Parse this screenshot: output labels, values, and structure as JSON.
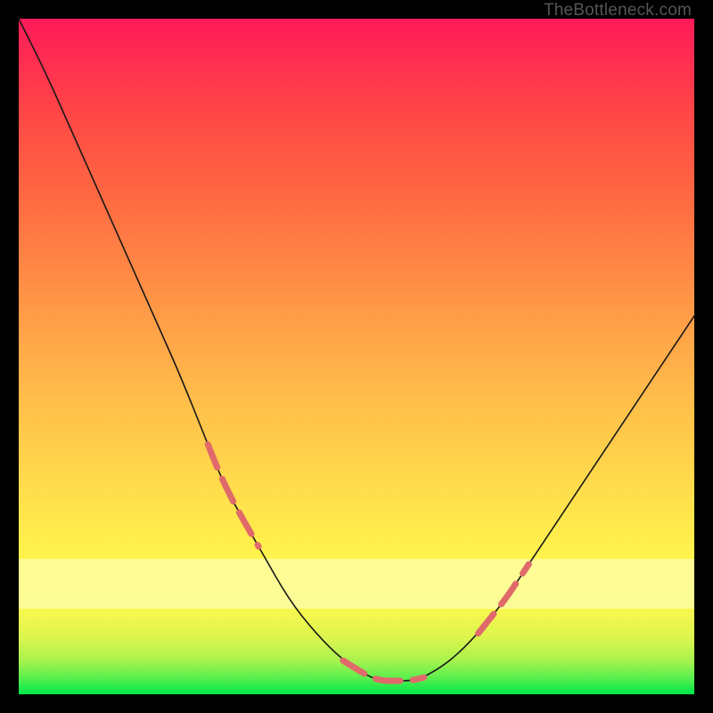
{
  "watermark": "TheBottleneck.com",
  "gradient": {
    "top": "#ff1a5a",
    "mid_upper": "#ff8244",
    "mid": "#fff84c",
    "lower_band": "#ffffd2",
    "bottom": "#00e64a"
  },
  "chart_data": {
    "type": "line",
    "title": "",
    "xlabel": "",
    "ylabel": "",
    "xlim": [
      0,
      100
    ],
    "ylim": [
      0,
      100
    ],
    "x": [
      0,
      4,
      8,
      12,
      16,
      20,
      24,
      28,
      30,
      32,
      36,
      40,
      44,
      48,
      52,
      54,
      56,
      58,
      60,
      64,
      68,
      72,
      76,
      80,
      84,
      88,
      92,
      96,
      100
    ],
    "series": [
      {
        "name": "bottleneck-curve",
        "color": "#181818",
        "values": [
          100,
          92,
          83,
          74,
          65,
          56,
          47,
          37,
          32,
          28,
          21,
          14,
          9,
          5,
          2.5,
          2,
          2,
          2,
          2.5,
          5,
          9,
          14,
          20,
          26,
          32,
          38,
          44,
          50,
          56
        ]
      }
    ],
    "annotations": [
      {
        "name": "accent-dash-left-down",
        "type": "dashed-segment",
        "color": "#e06a6a",
        "x_range": [
          28,
          36
        ],
        "note": "overlays main curve on left descending arm inside pale band"
      },
      {
        "name": "accent-dash-bottom",
        "type": "dashed-segment",
        "color": "#e06a6a",
        "x_range": [
          48,
          60
        ],
        "note": "overlays main curve along flat trough"
      },
      {
        "name": "accent-dash-right-up",
        "type": "dashed-segment",
        "color": "#e06a6a",
        "x_range": [
          68,
          76
        ],
        "note": "overlays main curve on right ascending arm inside pale band"
      }
    ],
    "background_band": {
      "y_range": [
        12,
        20
      ],
      "color": "#ffffd2",
      "opacity": 0.55
    }
  }
}
